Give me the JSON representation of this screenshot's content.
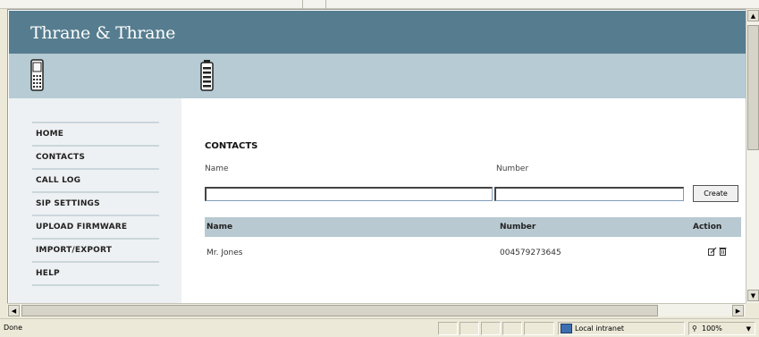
{
  "site": {
    "brand": "Thrane & Thrane"
  },
  "nav": {
    "items": [
      "HOME",
      "CONTACTS",
      "CALL LOG",
      "SIP SETTINGS",
      "UPLOAD FIRMWARE",
      "IMPORT/EXPORT",
      "HELP"
    ]
  },
  "contacts": {
    "title": "CONTACTS",
    "name_label": "Name",
    "number_label": "Number",
    "name_value": "",
    "number_value": "",
    "create_label": "Create",
    "table": {
      "headers": [
        "Name",
        "Number",
        "Action"
      ],
      "rows": [
        {
          "name": "Mr. Jones",
          "number": "004579273645",
          "actions": [
            "edit-icon",
            "delete-icon"
          ]
        }
      ]
    }
  },
  "browser": {
    "status_text": "Done",
    "zone_label": "Local intranet",
    "zoom_label": "100%",
    "zone_icon": "local-intranet-icon",
    "zoom_icon": "magnifier-icon"
  },
  "colors": {
    "brand_bar": "#567d8f",
    "phone_bar": "#b6cbd3",
    "table_header": "#b9c9d1",
    "nav_background": "#eef1f3"
  }
}
